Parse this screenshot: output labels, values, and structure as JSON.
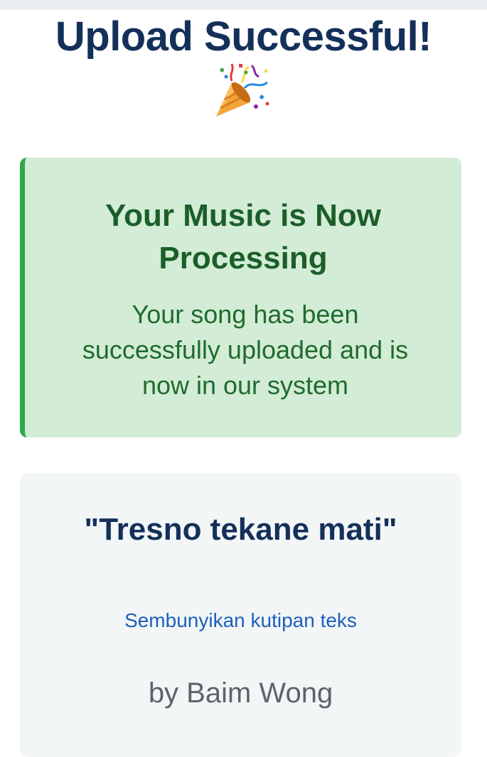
{
  "page": {
    "title": "Upload Successful!",
    "celebration_icon": "party-popper-icon"
  },
  "status": {
    "heading": "Your Music is Now Processing",
    "message": "Your song has been successfully uploaded and is now in our system"
  },
  "song": {
    "title": "\"Tresno tekane mati\"",
    "quote_toggle": "Sembunyikan kutipan teks",
    "artist": "by Baim Wong"
  },
  "colors": {
    "title": "#14305a",
    "success_bg": "#d3ecd6",
    "success_border": "#2ea84a",
    "success_text": "#1f6b2d",
    "link": "#1d5fbd",
    "artist": "#5f6368"
  }
}
